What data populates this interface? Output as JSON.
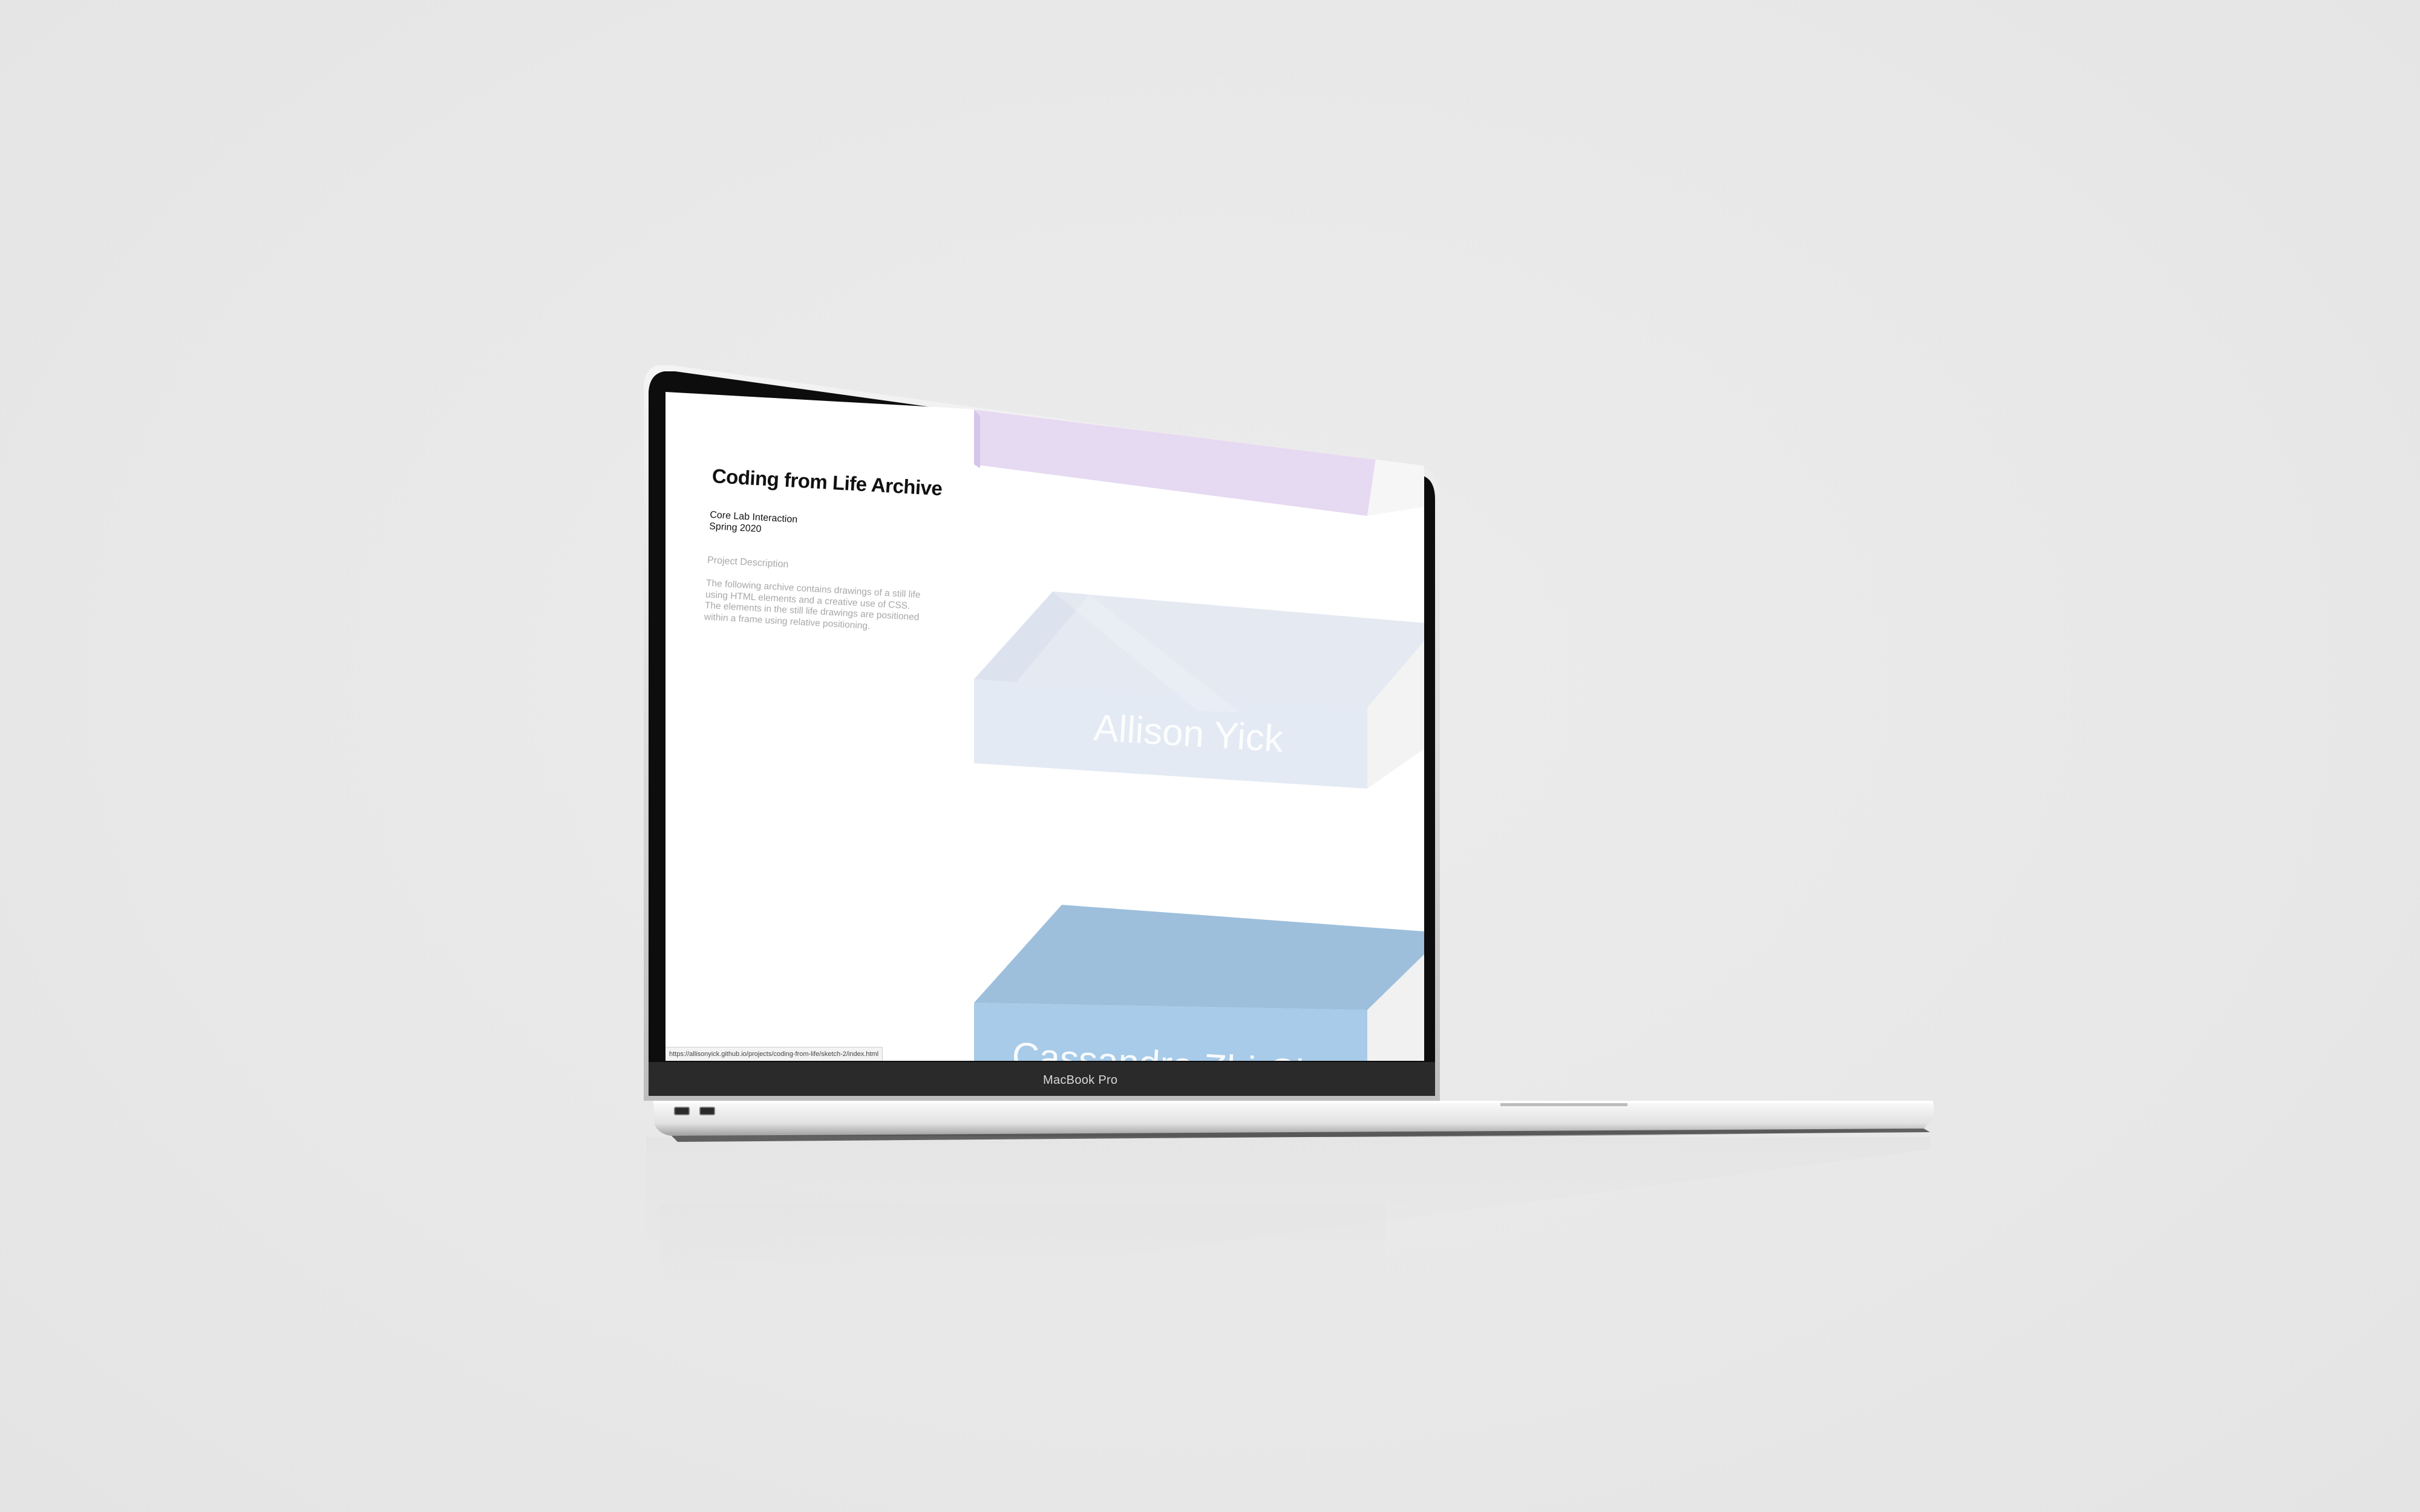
{
  "device": {
    "label": "MacBook Pro"
  },
  "browser": {
    "status_url": "https://allisonyick.github.io/projects/coding-from-life/sketch-2/index.html"
  },
  "page": {
    "title": "Coding from Life Archive",
    "course_line1": "Core Lab Interaction",
    "course_line2": "Spring 2020",
    "description_heading": "Project Description",
    "description_body": "The following archive contains drawings of a still life using HTML elements and a creative use of CSS. The elements in the still life drawings are positioned within a frame using relative positioning."
  },
  "archive": {
    "items": [
      {
        "name": "",
        "color": "#e6d9f2"
      },
      {
        "name": "Allison Yick",
        "color": "#e3eaf4"
      },
      {
        "name": "Cassandra Zhi-Chen M...",
        "color": "#a7cbe8"
      }
    ]
  },
  "colors": {
    "background": "#e9e9e9",
    "bezel": "#0d0d0d",
    "aluminum": "#c8c8c8",
    "slab_purple": "#e6d9f2",
    "slab_light_blue": "#e3eaf4",
    "slab_blue_top": "#9dbfdc",
    "slab_blue_front": "#a7cbe8"
  }
}
